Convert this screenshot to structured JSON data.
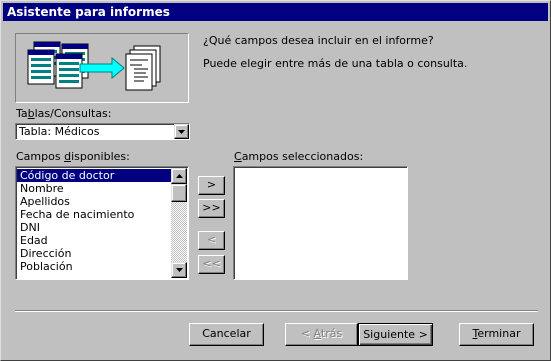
{
  "window": {
    "title": "Asistente para informes"
  },
  "intro": {
    "question": "¿Qué campos desea incluir en el informe?",
    "hint": "Puede elegir entre más de una tabla o consulta."
  },
  "tables": {
    "label_pre": "Ta",
    "label_key": "b",
    "label_post": "las/Consultas:",
    "selected": "Tabla: Médicos"
  },
  "available": {
    "label_pre": "Campos ",
    "label_key": "d",
    "label_post": "isponibles:",
    "items": [
      "Código de doctor",
      "Nombre",
      "Apellidos",
      "Fecha de nacimiento",
      "DNI",
      "Edad",
      "Dirección",
      "Población"
    ],
    "selected_index": 0
  },
  "selected_fields": {
    "label_pre": "",
    "label_key": "C",
    "label_post": "ampos seleccionados:",
    "items": []
  },
  "move_buttons": {
    "add_one": ">",
    "add_all": ">>",
    "remove_one": "<",
    "remove_all": "<<"
  },
  "footer": {
    "cancel": "Cancelar",
    "back_pre": "< ",
    "back_key": "A",
    "back_post": "trás",
    "next": "Siguiente >",
    "finish_key": "T",
    "finish_post": "erminar"
  }
}
